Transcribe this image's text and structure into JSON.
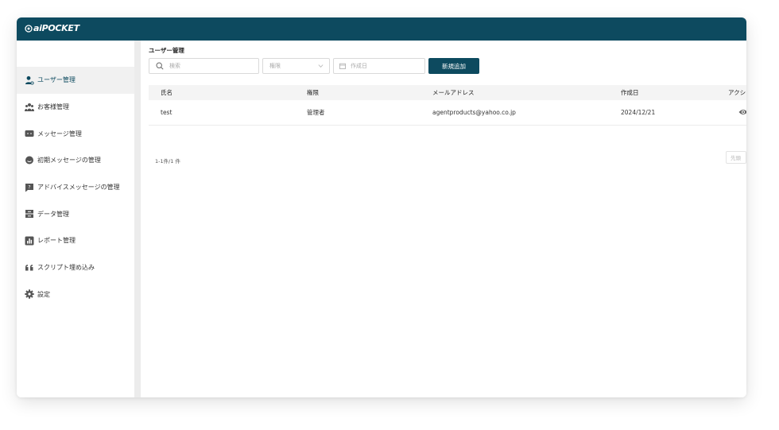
{
  "app": {
    "logo_text": "aiPOCKET",
    "brand_color": "#0d4a5f"
  },
  "sidebar": {
    "collapse_icon": "collapse-menu-icon",
    "items": [
      {
        "label": "ユーザー管理",
        "icon": "user-manage-icon",
        "active": true
      },
      {
        "label": "お客様管理",
        "icon": "customers-icon",
        "active": false
      },
      {
        "label": "メッセージ管理",
        "icon": "message-icon",
        "active": false
      },
      {
        "label": "初期メッセージの管理",
        "icon": "chat-bubble-icon",
        "active": false
      },
      {
        "label": "アドバイスメッセージの管理",
        "icon": "advice-icon",
        "active": false
      },
      {
        "label": "データ管理",
        "icon": "database-icon",
        "active": false
      },
      {
        "label": "レポート管理",
        "icon": "report-icon",
        "active": false
      },
      {
        "label": "スクリプト埋め込み",
        "icon": "quote-icon",
        "active": false
      },
      {
        "label": "設定",
        "icon": "gear-icon",
        "active": false
      }
    ]
  },
  "main": {
    "title": "ユーザー管理",
    "search": {
      "placeholder": "検索",
      "value": ""
    },
    "role_select": {
      "placeholder": "権限"
    },
    "date_filter": {
      "placeholder": "作成日",
      "value": ""
    },
    "add_button": "新規追加",
    "table": {
      "columns": [
        "氏名",
        "権限",
        "メールアドレス",
        "作成日",
        "アクシ"
      ],
      "rows": [
        {
          "name": "test",
          "role": "管理者",
          "email": "agentproducts@yahoo.co.jp",
          "created": "2024/12/21"
        }
      ]
    },
    "count_text": "1-1件/1 件",
    "pager_first": "先頭"
  }
}
